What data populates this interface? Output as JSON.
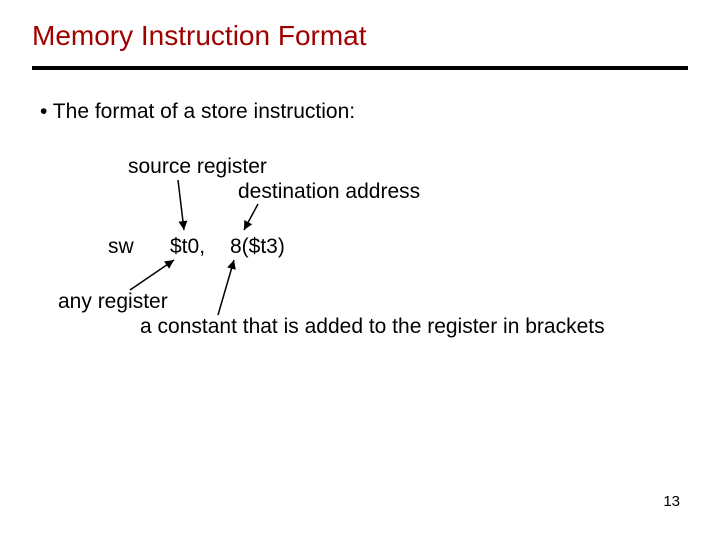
{
  "title": "Memory Instruction Format",
  "bullet": "• The format of a store instruction:",
  "labels": {
    "source_register": "source register",
    "destination_address": "destination address",
    "any_register": "any register",
    "constant_desc": "a constant that is added to the register in brackets"
  },
  "instruction": {
    "opcode": "sw",
    "operand1": "$t0,",
    "operand2": "8($t3)"
  },
  "page_number": "13"
}
